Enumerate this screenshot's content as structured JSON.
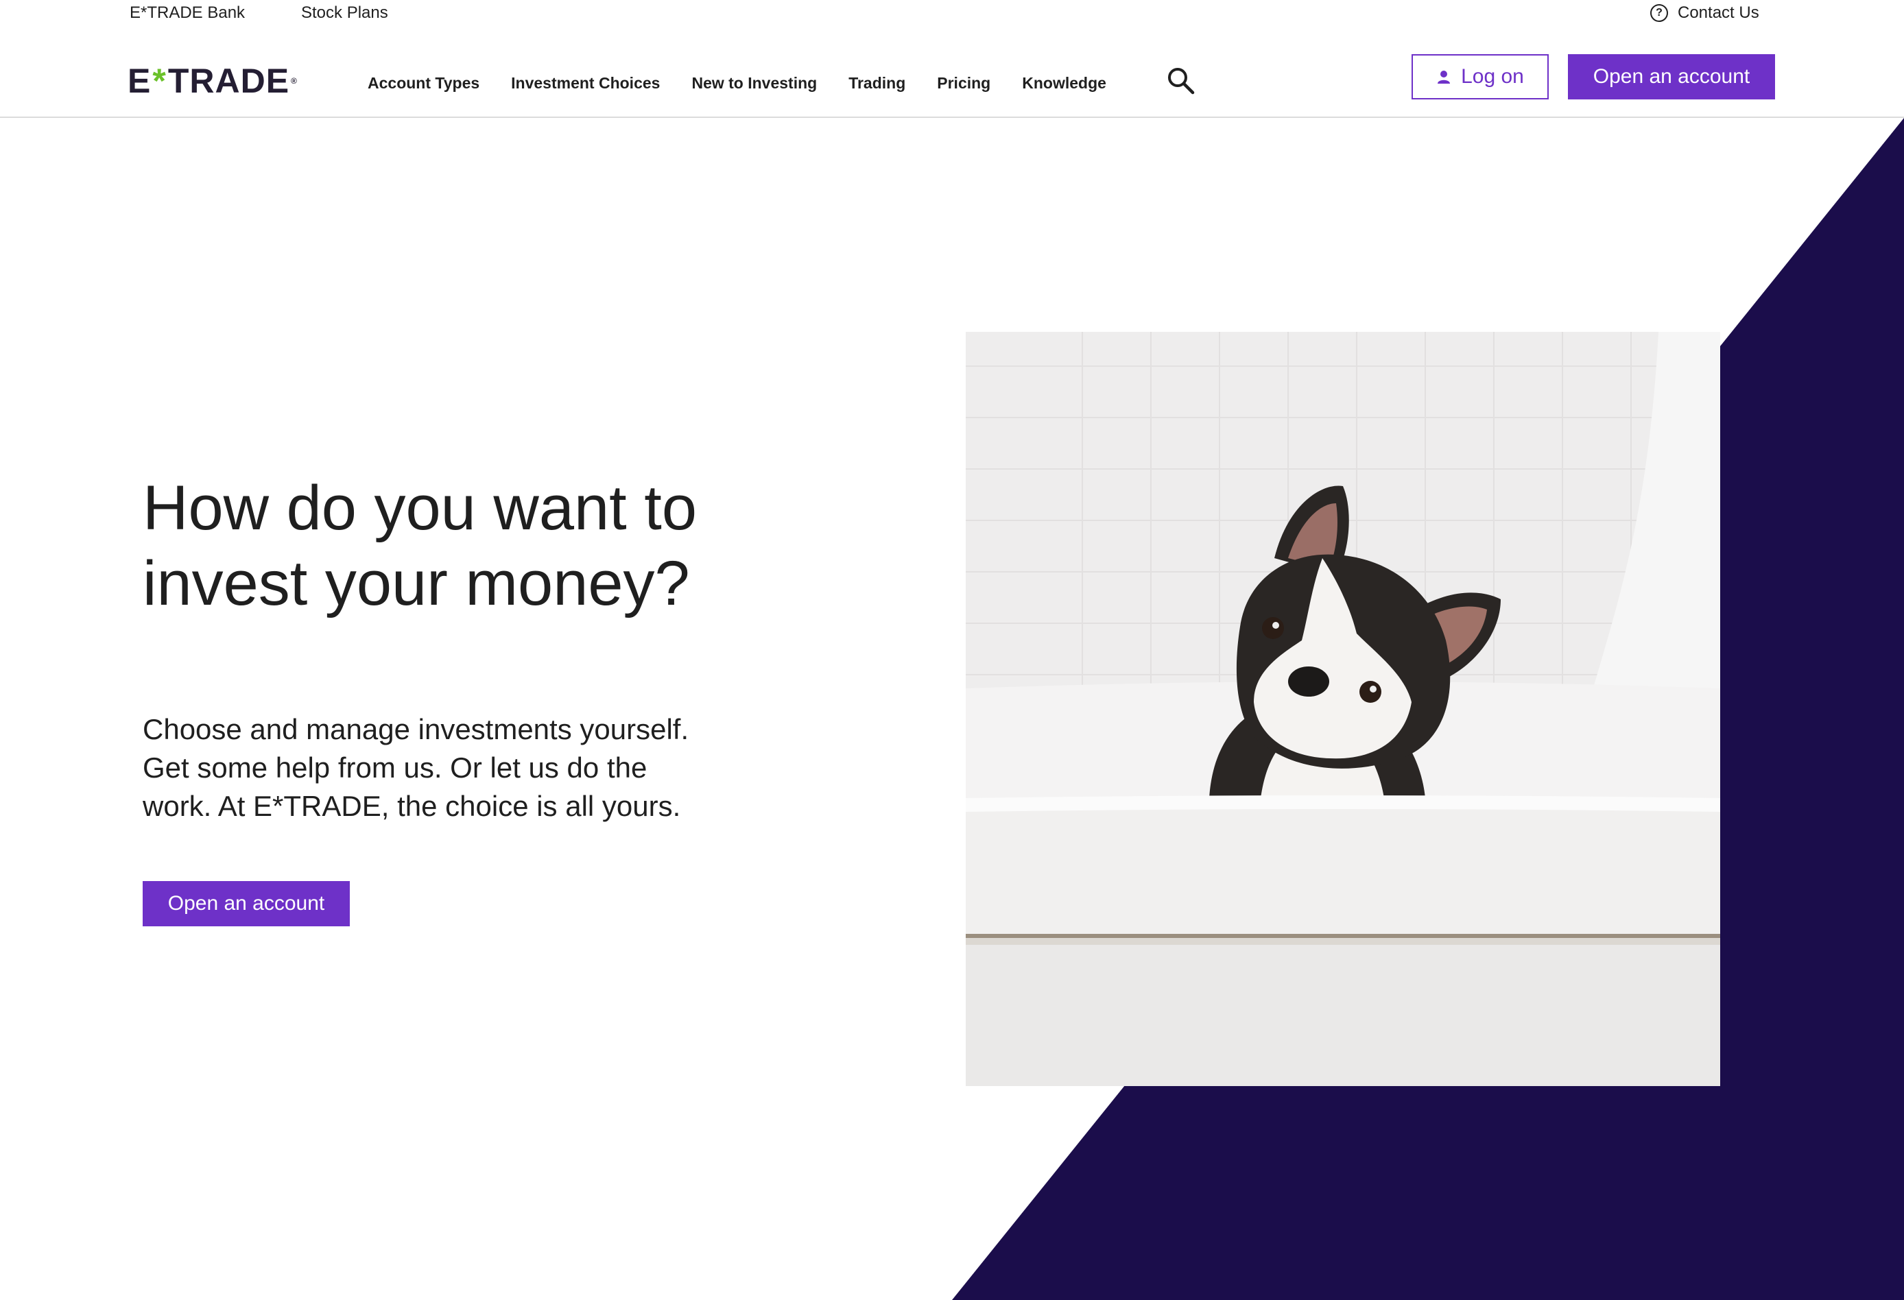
{
  "utility": {
    "bank": "E*TRADE Bank",
    "stock_plans": "Stock Plans",
    "contact": "Contact Us"
  },
  "brand": {
    "logo_text_left": "E",
    "logo_star": "*",
    "logo_text_right": "TRADE",
    "logo_reg": "®"
  },
  "nav": {
    "items": [
      "Account Types",
      "Investment Choices",
      "New to Investing",
      "Trading",
      "Pricing",
      "Knowledge"
    ]
  },
  "header_actions": {
    "logon_label": "Log on",
    "open_account_label": "Open an account"
  },
  "hero": {
    "title": "How do you want to invest your money?",
    "subtitle": "Choose and manage investments yourself. Get some help from us. Or let us do the work. At E*TRADE, the choice is all yours.",
    "cta_label": "Open an account"
  },
  "colors": {
    "accent_purple": "#6e31c8",
    "dark_navy": "#1b0d4b",
    "logo_green": "#6bc12a"
  }
}
